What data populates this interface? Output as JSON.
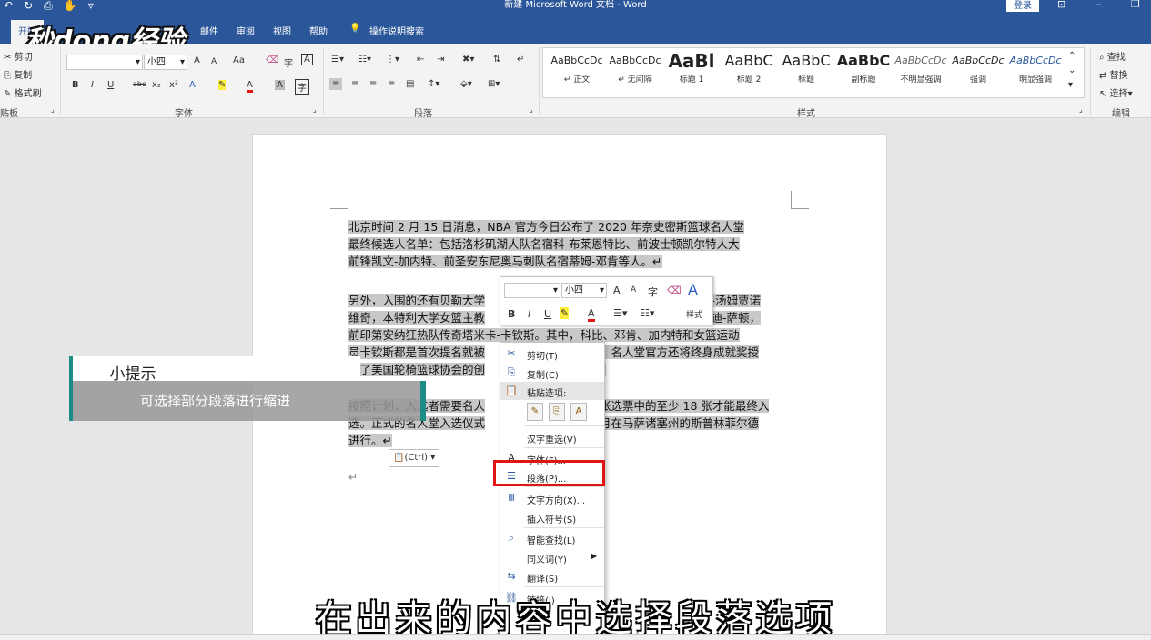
{
  "titlebar": {
    "doc_title": "新建 Microsoft Word 文档 - Word",
    "login": "登录",
    "qat_icons": [
      "undo-icon",
      "redo-icon",
      "print-preview-icon",
      "touch-mode-icon",
      "customize-icon"
    ]
  },
  "tabs": [
    "开始",
    "邮件",
    "审阅",
    "视图",
    "帮助"
  ],
  "tell_me": "操作说明搜索",
  "logo": "秒dong经验",
  "clipboard": {
    "cut": "剪切",
    "copy": "复制",
    "format_painter": "格式刷",
    "group": "贴板"
  },
  "font": {
    "size": "小四",
    "group": "字体",
    "grow": "A",
    "shrink": "A",
    "case": "Aa",
    "bold": "B",
    "italic": "I",
    "underline": "U",
    "strike": "abc",
    "sub": "x₂",
    "sup": "x²",
    "color_a": "A"
  },
  "paragraph": {
    "group": "段落"
  },
  "styles": {
    "group": "样式",
    "items": [
      {
        "sample": "AaBbCcDc",
        "name": "↵ 正文"
      },
      {
        "sample": "AaBbCcDc",
        "name": "↵ 无间隔"
      },
      {
        "sample": "AaBl",
        "name": "标题 1"
      },
      {
        "sample": "AaBbC",
        "name": "标题 2"
      },
      {
        "sample": "AaBbC",
        "name": "标题"
      },
      {
        "sample": "AaBbC",
        "name": "副标题"
      },
      {
        "sample": "AaBbCcDc",
        "name": "不明显强调"
      },
      {
        "sample": "AaBbCcDc",
        "name": "强调"
      },
      {
        "sample": "AaBbCcDc",
        "name": "明显强调"
      }
    ]
  },
  "editing": {
    "find": "查找",
    "replace": "替换",
    "select": "选择",
    "group": "编辑"
  },
  "document": {
    "para1": [
      "北京时间 2 月 15 日消息，NBA 官方今日公布了 2020 年奈史密斯篮球名人堂",
      "最终候选人名单：包括洛杉矶湖人队名宿科-布莱恩特比、前波士顿凯尔特人大",
      "前锋凯文-加内特、前圣安东尼奥马刺队名宿蒂姆-邓肯等人。↵"
    ],
    "para2": [
      "另外，入围的还有贝勒大学",
      "迪-汤姆贾诺",
      "维奇，本特利大学女篮主教",
      "艾迪-萨顿，",
      "前印第安纳狂热队传奇塔米卡-卡钦斯。其中，科比、邓肯、加内特和女篮运动",
      "员卡钦斯都是首次提名就被",
      "。名人堂官方还将终身成就奖授",
      "予了美国轮椅篮球协会的创",
      "。↵"
    ],
    "para3": [
      "按照计划，入选者需要名人",
      "张选票中的至少 18 张才能最终入",
      "选。正式的名人堂入选仪式",
      "月在马萨诸塞州的斯普林菲尔德",
      "进行。↵"
    ],
    "empty_mark": "↵"
  },
  "mini_toolbar": {
    "size": "小四",
    "styles": "样式"
  },
  "paste_button": "(Ctrl)",
  "context_menu": {
    "cut": "剪切(T)",
    "copy": "复制(C)",
    "paste_options": "粘贴选项:",
    "reconvert": "汉字重选(V)",
    "font": "字体(F)...",
    "paragraph": "段落(P)...",
    "text_direction": "文字方向(X)...",
    "insert_symbol": "插入符号(S)",
    "smart_lookup": "智能查找(L)",
    "synonyms": "同义词(Y)",
    "translate": "翻译(S)",
    "link": "链接(I)"
  },
  "tip": {
    "title": "小提示",
    "text": "可选择部分段落进行缩进"
  },
  "subtitle": "在出来的内容中选择段落选项",
  "colors": {
    "word_blue": "#2b579a",
    "accent_teal": "#1e8c86",
    "highlight_red": "#e01414",
    "selection_gray": "#c8c8c8"
  }
}
